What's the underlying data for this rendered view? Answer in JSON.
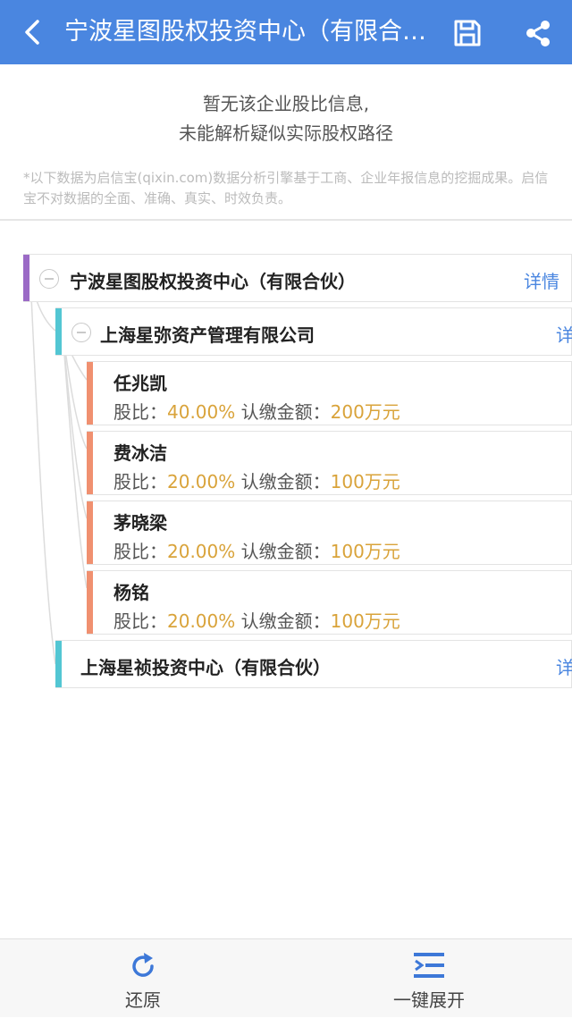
{
  "header": {
    "title": "宁波星图股权投资中心（有限合…"
  },
  "notice": {
    "line1": "暂无该企业股比信息,",
    "line2": "未能解析疑似实际股权路径"
  },
  "disclaimer": "*以下数据为启信宝(qixin.com)数据分析引擎基于工商、企业年报信息的挖掘成果。启信宝不对数据的全面、准确、真实、时效负责。",
  "tree": {
    "root": {
      "name": "宁波星图股权投资中心（有限合伙）",
      "detail": "详情"
    },
    "children": [
      {
        "name": "上海星弥资产管理有限公司",
        "detail": "详"
      },
      {
        "name": "上海星祯投资中心（有限合伙）",
        "detail": "详"
      }
    ],
    "shareholders": [
      {
        "name": "任兆凯",
        "ratio_label": "股比：",
        "ratio": "40.00%",
        "amount_label": "认缴金额：",
        "amount": "200万元"
      },
      {
        "name": "费冰洁",
        "ratio_label": "股比：",
        "ratio": "20.00%",
        "amount_label": "认缴金额：",
        "amount": "100万元"
      },
      {
        "name": "茅晓梁",
        "ratio_label": "股比：",
        "ratio": "20.00%",
        "amount_label": "认缴金额：",
        "amount": "100万元"
      },
      {
        "name": "杨铭",
        "ratio_label": "股比：",
        "ratio": "20.00%",
        "amount_label": "认缴金额：",
        "amount": "100万元"
      }
    ]
  },
  "bottombar": {
    "restore_label": "还原",
    "expand_label": "一键展开"
  },
  "colors": {
    "header_bg": "#4a86e0",
    "root_stripe": "#9b6ac6",
    "company_stripe": "#53c6d3",
    "person_stripe": "#f09070",
    "highlight": "#d9a33a"
  },
  "icons": [
    "back-arrow-icon",
    "save-icon",
    "share-icon",
    "collapse-icon",
    "refresh-icon",
    "expand-all-icon"
  ]
}
